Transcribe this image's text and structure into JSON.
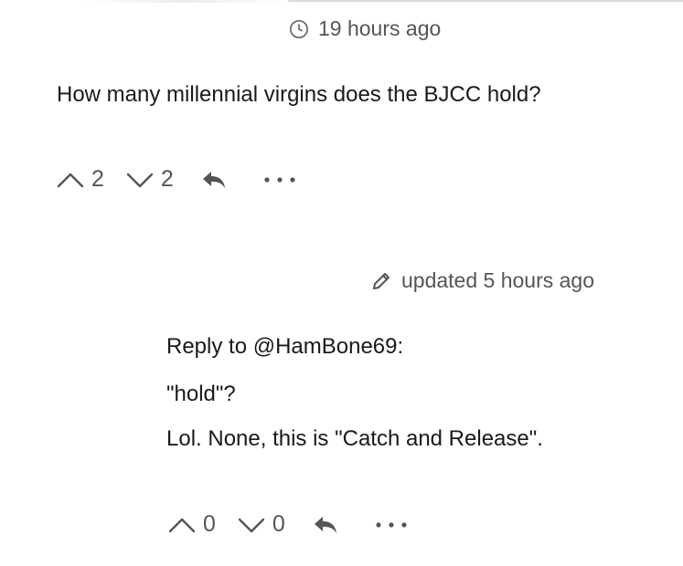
{
  "comment": {
    "timestamp": "19 hours ago",
    "text": "How many millennial virgins does the BJCC hold?",
    "upvotes": "2",
    "downvotes": "2"
  },
  "reply": {
    "timestamp": "updated 5 hours ago",
    "line1": "Reply to @HamBone69:",
    "line2": "\"hold\"?",
    "line3": "Lol. None, this is \"Catch and Release\".",
    "upvotes": "0",
    "downvotes": "0"
  },
  "icons": {
    "clock": "clock-icon",
    "pencil": "pencil-icon",
    "upvote": "chevron-up-icon",
    "downvote": "chevron-down-icon",
    "reply": "reply-arrow-icon",
    "more": "more-dots-icon"
  }
}
